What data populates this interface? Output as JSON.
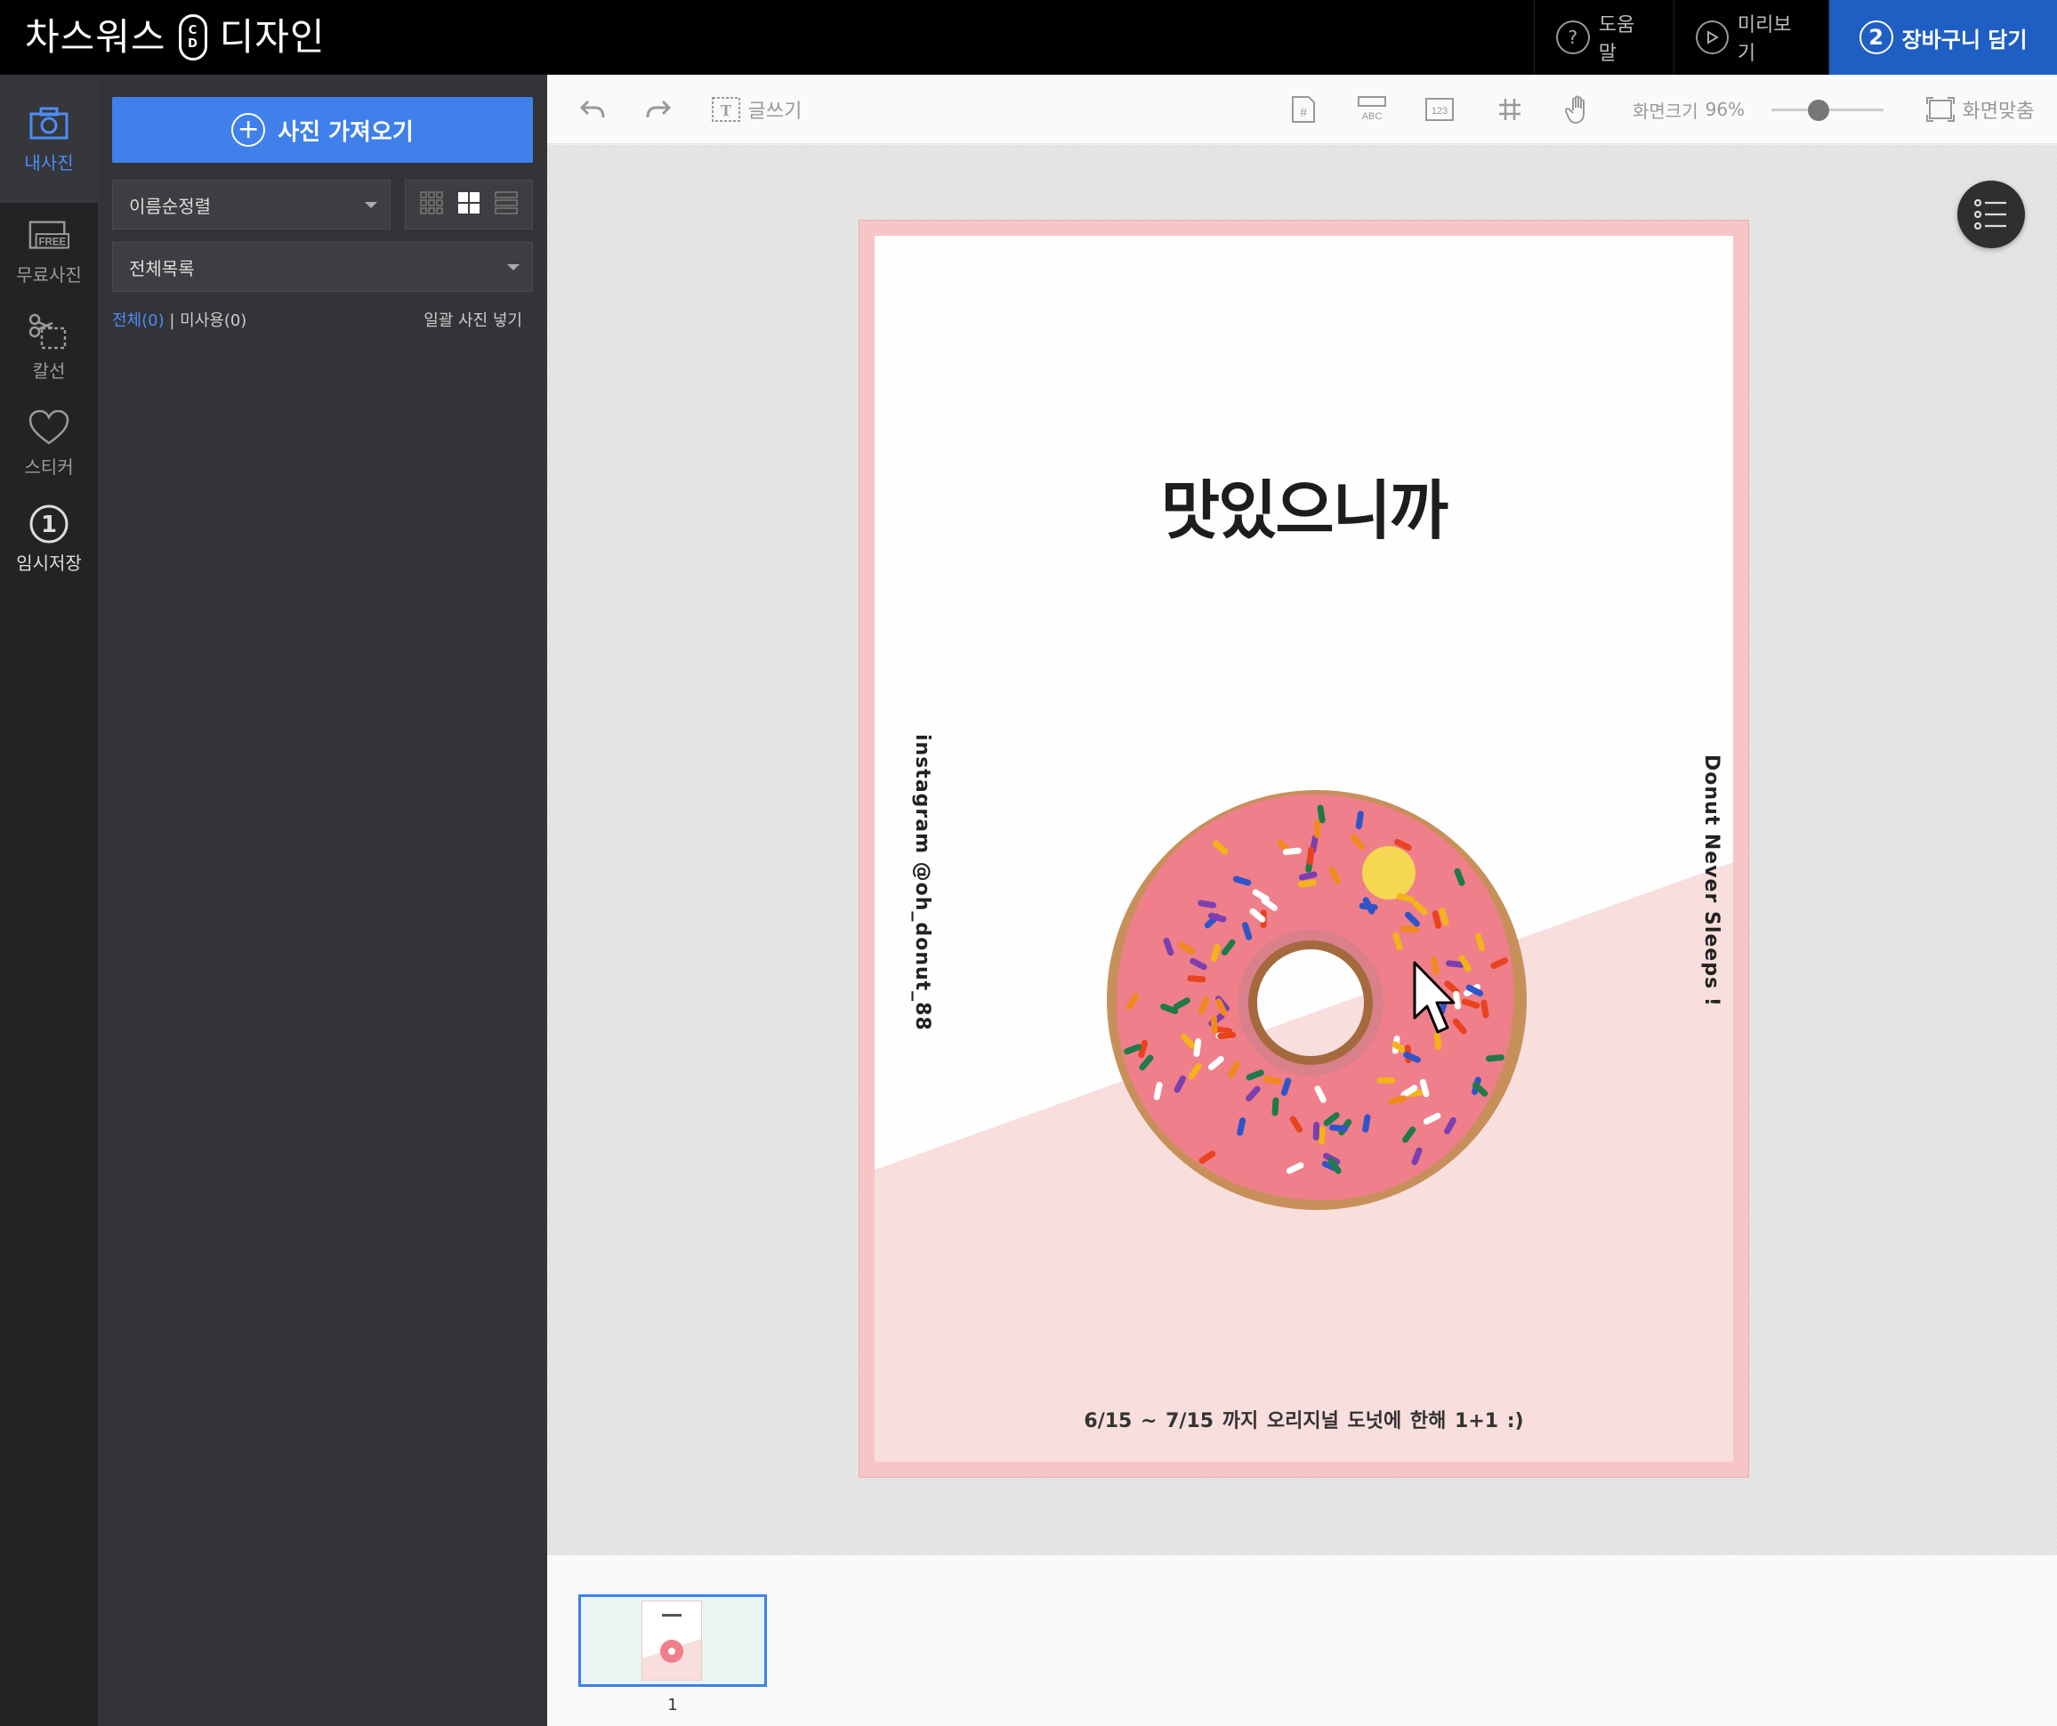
{
  "topbar": {
    "brand_left": "차스워스",
    "brand_logo": [
      "C",
      "D"
    ],
    "brand_right": "디자인",
    "help_label": "도움말",
    "help_icon": "question-icon",
    "preview_label": "미리보기",
    "preview_icon": "play-icon",
    "cart_step": "2",
    "cart_label": "장바구니 담기"
  },
  "leftnav": {
    "items": [
      {
        "label": "내사진",
        "icon": "camera-icon",
        "active": true
      },
      {
        "label": "무료사진",
        "icon": "free-photo-icon",
        "badge": "FREE"
      },
      {
        "label": "칼선",
        "icon": "scissors-icon"
      },
      {
        "label": "스티커",
        "icon": "heart-icon"
      },
      {
        "label": "임시저장",
        "icon": "temp-save-icon",
        "number": "1"
      }
    ]
  },
  "panel": {
    "import_label": "사진 가져오기",
    "sort_value": "이름순정렬",
    "folder_value": "전체목록",
    "filter_all": "전체(0)",
    "filter_sep": " | ",
    "filter_unused": "미사용(0)",
    "bulk_insert": "일괄 사진 넣기"
  },
  "toolbar": {
    "text_label": "글쓰기",
    "zoom_label": "화면크기",
    "zoom_value": "96%",
    "zoom_level": 0.42,
    "fit_label": "화면맞춤",
    "abc_label": "ABC",
    "num_label": "123"
  },
  "poster": {
    "title": "맛있으니까",
    "left_vertical": "instagram @oh_donut_88",
    "right_vertical": "Donut Never Sleeps !",
    "footer": "6/15 ~ 7/15 까지  오리지널 도넛에 한해 1+1   :)"
  },
  "colors": {
    "accent": "#3f80ea",
    "cart": "#1f5fc4",
    "poster_border": "#f7c5c6",
    "poster_pink": "#f9dede",
    "donut_icing": "#ef7f8a"
  },
  "filmstrip": {
    "page_number": "1"
  }
}
